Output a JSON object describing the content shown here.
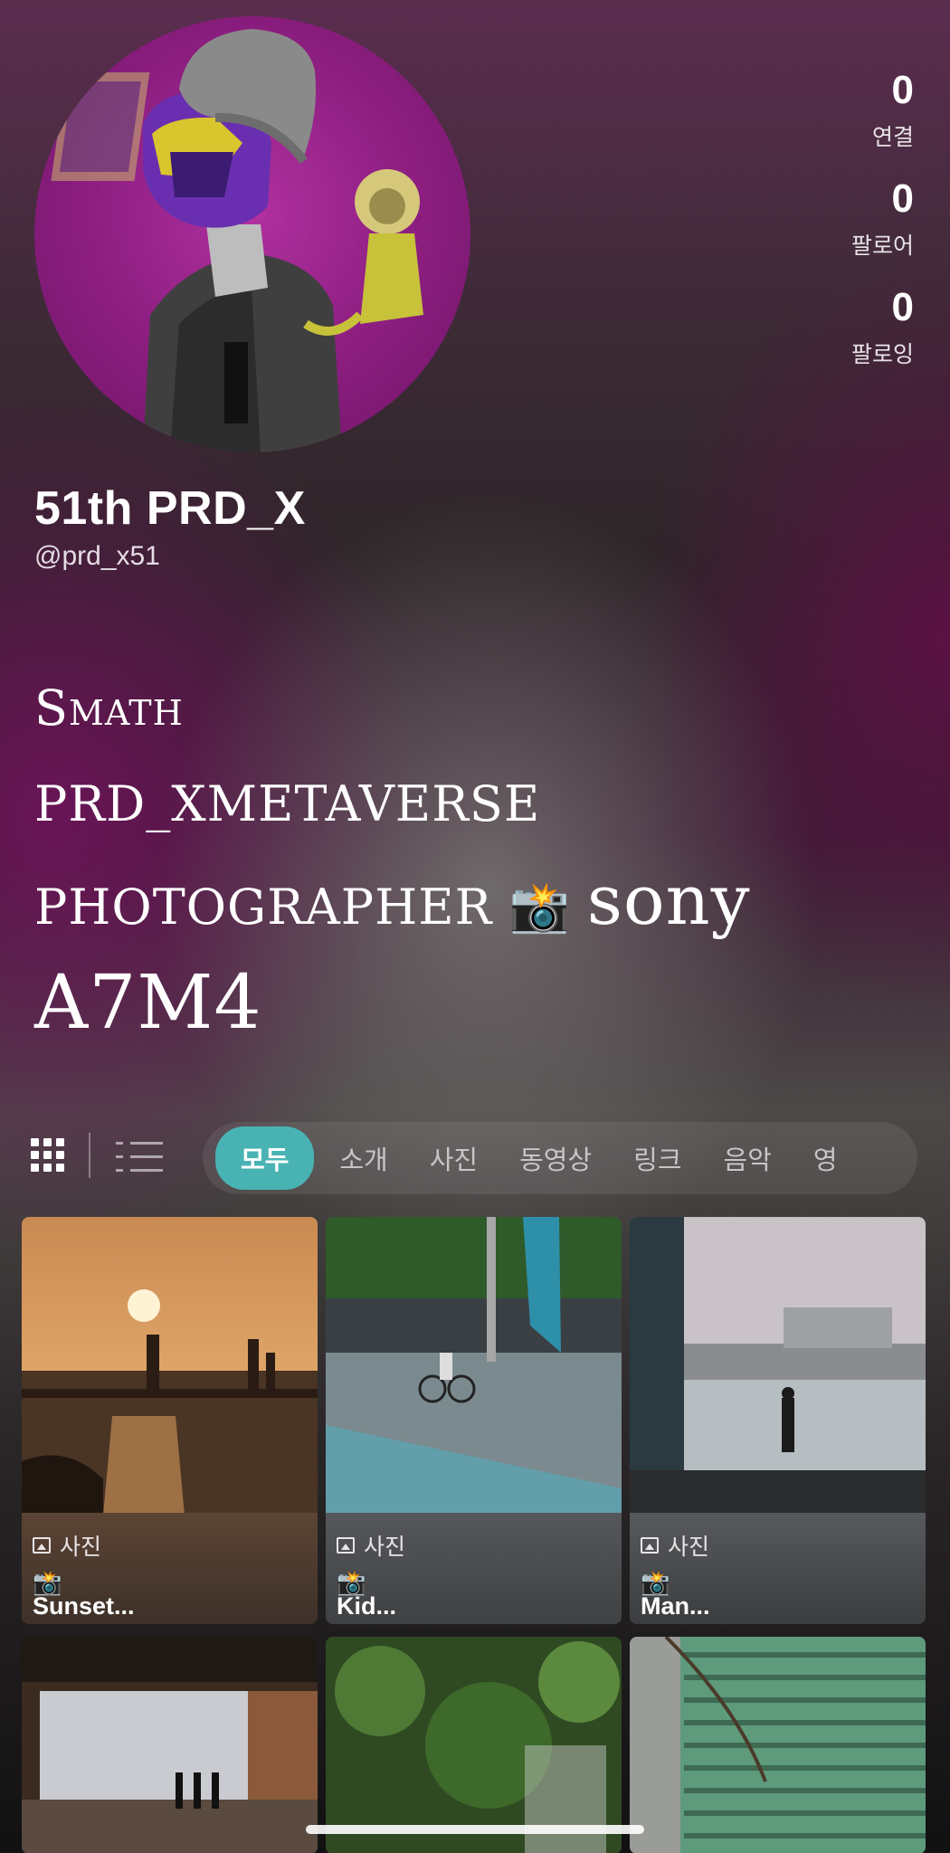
{
  "profile": {
    "display_name": "51th PRD_X",
    "handle": "@prd_x51",
    "avatar_icon": "avatar-image"
  },
  "stats": [
    {
      "value": "0",
      "label": "연결"
    },
    {
      "value": "0",
      "label": "팔로어"
    },
    {
      "value": "0",
      "label": "팔로잉"
    }
  ],
  "bio": {
    "line1": "Smath",
    "line2": "PRD_XMETAVERSE",
    "line3a": "PHOTOGRAPHER",
    "line3_emoji": "📸",
    "line3b": "sony",
    "line4": "A7M4"
  },
  "toolbar": {
    "grid_view_icon": "grid-view-icon",
    "list_view_icon": "list-view-icon",
    "tabs": [
      {
        "label": "모두",
        "active": true
      },
      {
        "label": "소개"
      },
      {
        "label": "사진"
      },
      {
        "label": "동영상"
      },
      {
        "label": "링크"
      },
      {
        "label": "음악"
      },
      {
        "label": "영"
      }
    ]
  },
  "posts": [
    {
      "type": "사진",
      "emoji": "📸",
      "title": "Sunset..."
    },
    {
      "type": "사진",
      "emoji": "📸",
      "title": "Kid..."
    },
    {
      "type": "사진",
      "emoji": "📸",
      "title": "Man..."
    }
  ],
  "colors": {
    "accent": "#49b3b4",
    "avatar_bg": "#9a2490"
  }
}
